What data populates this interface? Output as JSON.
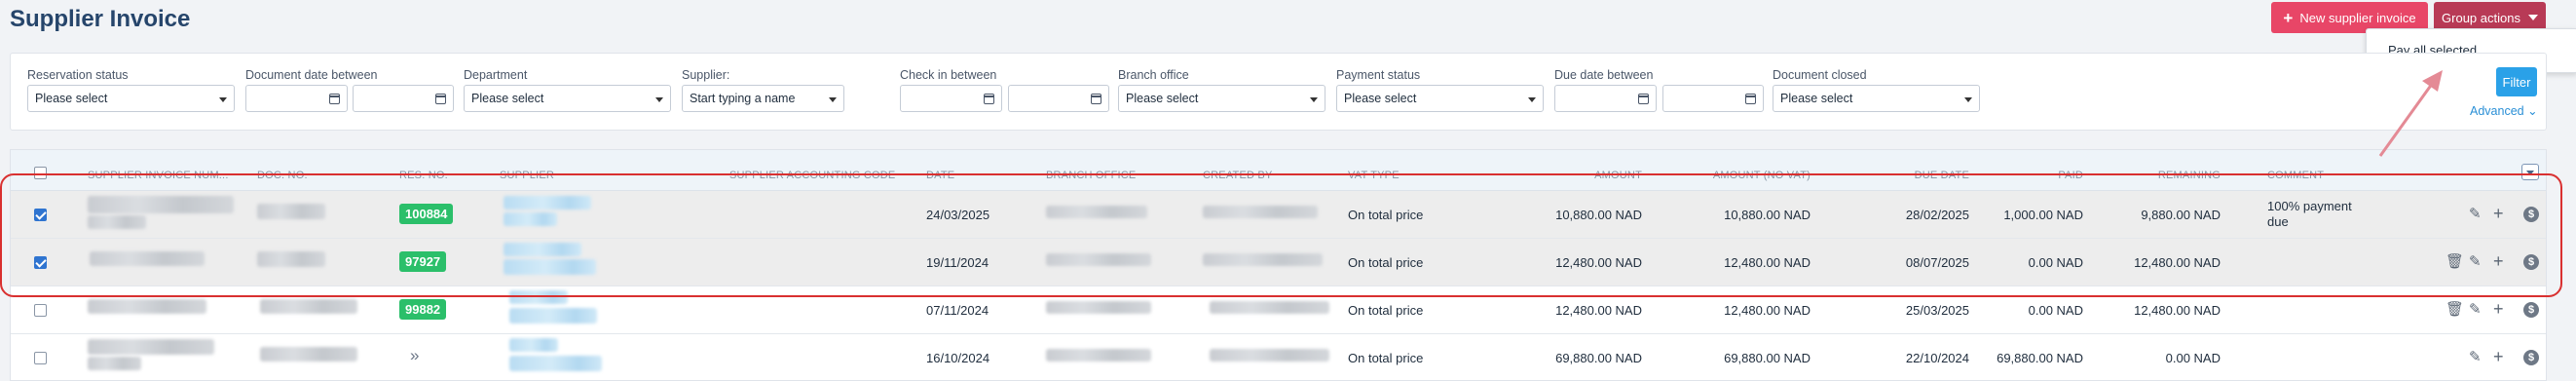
{
  "page": {
    "title": "Supplier Invoice"
  },
  "header": {
    "new_invoice_label": "New supplier invoice",
    "group_actions_label": "Group actions",
    "group_actions_menu": [
      "Pay all selected"
    ]
  },
  "filters": {
    "reservation_status": {
      "label": "Reservation status",
      "placeholder": "Please select"
    },
    "document_date": {
      "label": "Document date between"
    },
    "department": {
      "label": "Department",
      "placeholder": "Please select"
    },
    "supplier": {
      "label": "Supplier:",
      "placeholder": "Start typing a name"
    },
    "check_in": {
      "label": "Check in between"
    },
    "branch_office": {
      "label": "Branch office",
      "placeholder": "Please select"
    },
    "payment_status": {
      "label": "Payment status",
      "placeholder": "Please select"
    },
    "due_date": {
      "label": "Due date between"
    },
    "document_closed": {
      "label": "Document closed",
      "placeholder": "Please select"
    },
    "filter_button": "Filter",
    "advanced_link": "Advanced"
  },
  "table": {
    "columns": [
      "SUPPLIER INVOICE NUM...",
      "DOC. NO.",
      "RES. NO.",
      "SUPPLIER",
      "SUPPLIER ACCOUNTING CODE",
      "DATE",
      "BRANCH OFFICE",
      "CREATED BY",
      "VAT TYPE",
      "AMOUNT",
      "AMOUNT (NO VAT)",
      "DUE DATE",
      "PAID",
      "REMAINING",
      "COMMENT"
    ],
    "rows": [
      {
        "selected": true,
        "res_no": "100884",
        "date": "24/03/2025",
        "vat_type": "On total price",
        "amount": "10,880.00 NAD",
        "amount_no_vat": "10,880.00 NAD",
        "due_date": "28/02/2025",
        "paid": "1,000.00 NAD",
        "remaining": "9,880.00 NAD",
        "comment_line1": "100% payment",
        "comment_line2": "due",
        "has_delete": false
      },
      {
        "selected": true,
        "res_no": "97927",
        "date": "19/11/2024",
        "vat_type": "On total price",
        "amount": "12,480.00 NAD",
        "amount_no_vat": "12,480.00 NAD",
        "due_date": "08/07/2025",
        "paid": "0.00 NAD",
        "remaining": "12,480.00 NAD",
        "comment_line1": "",
        "comment_line2": "",
        "has_delete": true
      },
      {
        "selected": false,
        "res_no": "99882",
        "date": "07/11/2024",
        "vat_type": "On total price",
        "amount": "12,480.00 NAD",
        "amount_no_vat": "12,480.00 NAD",
        "due_date": "25/03/2025",
        "paid": "0.00 NAD",
        "remaining": "12,480.00 NAD",
        "comment_line1": "",
        "comment_line2": "",
        "has_delete": true
      },
      {
        "selected": false,
        "res_no": "»",
        "date": "16/10/2024",
        "vat_type": "On total price",
        "amount": "69,880.00 NAD",
        "amount_no_vat": "69,880.00 NAD",
        "due_date": "22/10/2024",
        "paid": "69,880.00 NAD",
        "remaining": "0.00 NAD",
        "comment_line1": "",
        "comment_line2": "",
        "has_delete": false
      }
    ]
  },
  "colors": {
    "accent_red": "#e84667",
    "group_red": "#b83a56",
    "filter_blue": "#2aa1e8",
    "badge_green": "#2bbf6a",
    "highlight_red": "#d93030",
    "arrow_pink": "#e48a95"
  },
  "icons": [
    "plus-icon",
    "chevron-down-icon",
    "calendar-icon",
    "pencil-icon",
    "trash-icon",
    "dollar-icon",
    "double-chevron-icon"
  ]
}
